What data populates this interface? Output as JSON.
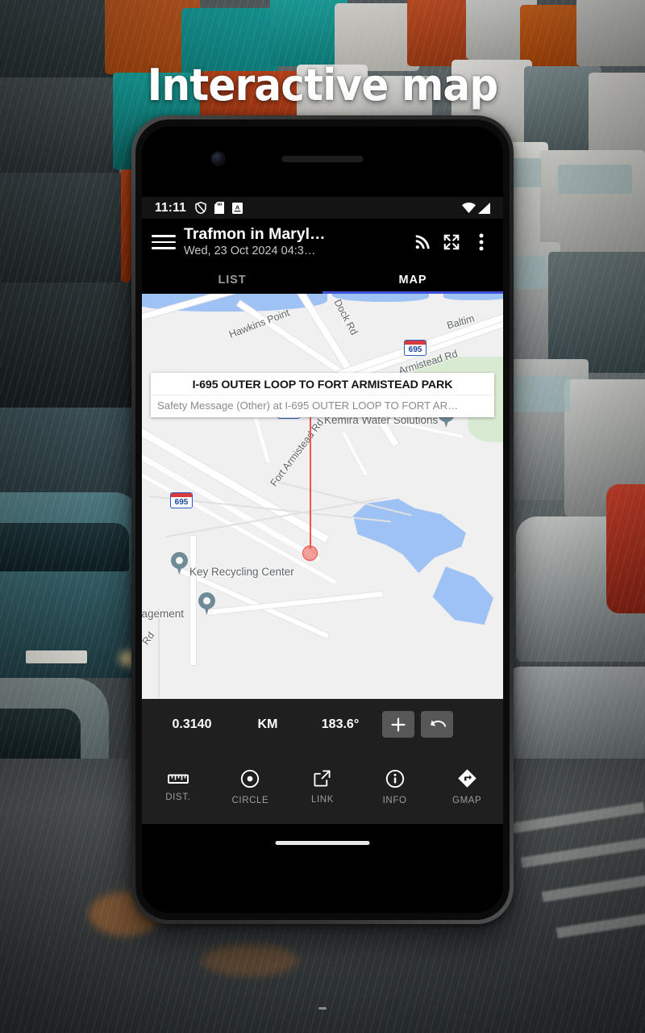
{
  "headline": "Interactive map",
  "status_bar": {
    "time": "11:11",
    "icons": [
      "shield-icon",
      "sd-card-icon",
      "a-badge-icon"
    ],
    "right_icons": [
      "wifi-icon",
      "signal-icon"
    ]
  },
  "app_bar": {
    "menu_icon": "hamburger-menu-icon",
    "title": "Trafmon in Maryl…",
    "subtitle": "Wed, 23 Oct 2024 04:3…",
    "actions": [
      {
        "name": "rss-feed-icon"
      },
      {
        "name": "fullscreen-expand-icon"
      },
      {
        "name": "overflow-menu-icon"
      }
    ]
  },
  "tabs": [
    {
      "label": "LIST",
      "active": false
    },
    {
      "label": "MAP",
      "active": true
    }
  ],
  "map": {
    "info_card": {
      "title": "I-695 OUTER LOOP TO FORT ARMISTEAD PARK",
      "subtitle": "Safety Message (Other) at  I-695 OUTER LOOP TO FORT AR…"
    },
    "road_labels": [
      "Hawkins Point",
      "Dock Rd",
      "Baltim",
      "Armistead Rd",
      "Fort Armistead Rd",
      "Rd"
    ],
    "place_labels": [
      "Kemira Water Solutions",
      "Key Recycling Center",
      "nagement"
    ],
    "highway_shields": [
      "695",
      "695",
      "695"
    ],
    "incident_marker": "!",
    "colors": {
      "water": "#9fc2f5",
      "park": "#d9ead3",
      "incident_green": "#19a84c",
      "measure_red": "#ef4a42",
      "tab_indicator": "#3f51d8"
    }
  },
  "measure_bar": {
    "distance": "0.3140",
    "unit": "KM",
    "bearing": "183.6°",
    "add_button": "+",
    "undo_button": "undo-icon"
  },
  "toolbar": [
    {
      "icon": "ruler-icon",
      "label": "DIST."
    },
    {
      "icon": "circle-target-icon",
      "label": "CIRCLE"
    },
    {
      "icon": "external-link-icon",
      "label": "LINK"
    },
    {
      "icon": "info-icon",
      "label": "INFO"
    },
    {
      "icon": "gmap-navigation-icon",
      "label": "GMAP"
    }
  ]
}
